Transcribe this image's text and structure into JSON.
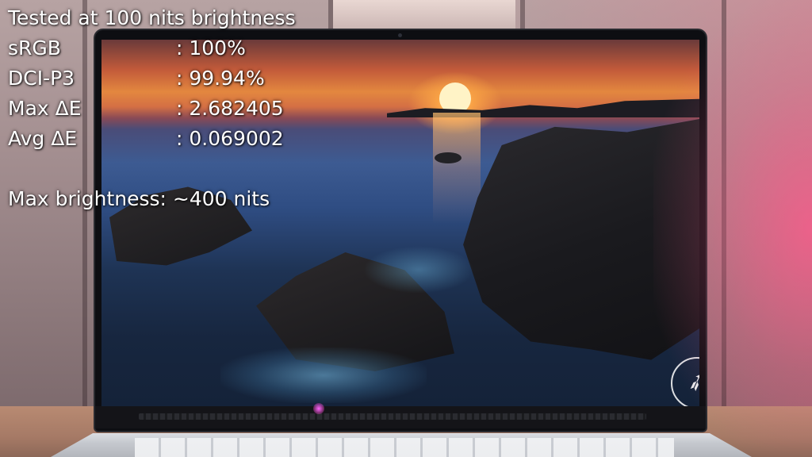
{
  "overlay": {
    "title": "Tested at 100 nits brightness",
    "metrics": [
      {
        "label": "sRGB",
        "value": ": 100%"
      },
      {
        "label": "DCI-P3",
        "value": ": 99.94%"
      },
      {
        "label": "Max ΔE",
        "value": ": 2.682405"
      },
      {
        "label": "Avg ΔE",
        "value": ": 0.069002"
      }
    ],
    "max_brightness": "Max brightness: ~400 nits"
  },
  "logo": {
    "icon": "compass-arrows-icon",
    "glyph": "➶"
  },
  "colors": {
    "text": "#ffffff",
    "glow_right": "#ff5a8c"
  }
}
